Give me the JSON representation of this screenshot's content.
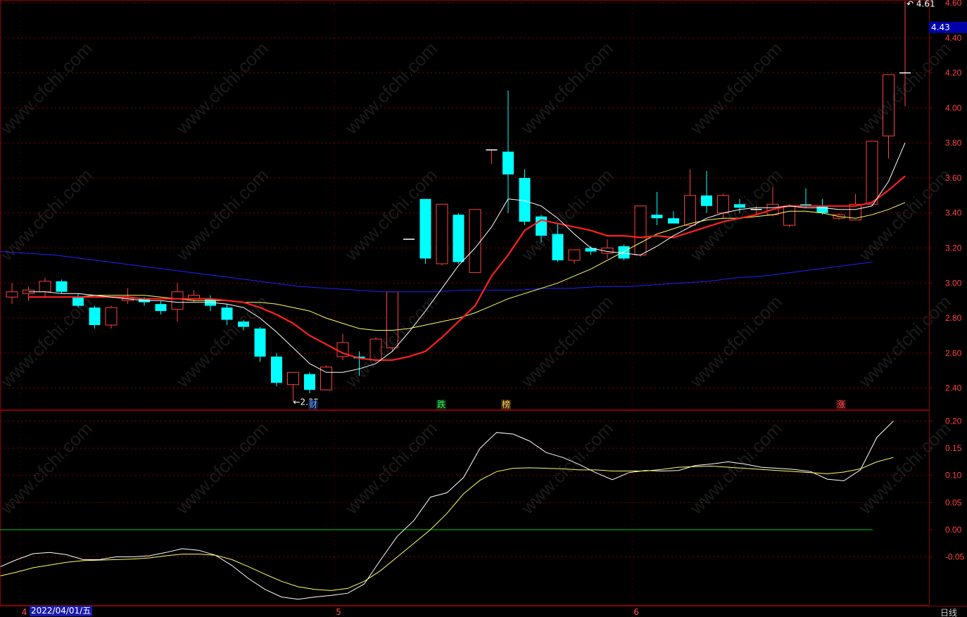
{
  "period_label": "日线",
  "current_price": "4.43",
  "cursor_date": "2022/04/01/五",
  "colors": {
    "up": "#ff4040",
    "down": "#00ffff",
    "ma_fast": "#ffffff",
    "ma_mid": "#ff2020",
    "ma_slow": "#ffff66",
    "ma_long": "#2020ff",
    "zero_line": "#00cc00",
    "grid": "#8b0000",
    "tick_text": "#ff4040"
  },
  "month_labels": [
    "4",
    "5",
    "6"
  ],
  "event_markers": [
    {
      "label": "财",
      "color": "#66aaff"
    },
    {
      "label": "跌",
      "color": "#33ff66"
    },
    {
      "label": "榜",
      "color": "#ffcc66"
    },
    {
      "label": "涨",
      "color": "#ff5555"
    }
  ],
  "annotations": {
    "low": "2.32",
    "high": "4.61"
  },
  "chart_data": [
    {
      "type": "candlestick",
      "ylim": [
        2.25,
        4.6
      ],
      "yticks": [
        "4.60",
        "4.40",
        "4.20",
        "4.00",
        "3.80",
        "3.60",
        "3.40",
        "3.20",
        "3.00",
        "2.80",
        "2.60",
        "2.40"
      ],
      "candles": [
        {
          "o": 2.92,
          "h": 3.0,
          "l": 2.88,
          "c": 2.95
        },
        {
          "o": 2.94,
          "h": 2.98,
          "l": 2.9,
          "c": 2.96
        },
        {
          "o": 2.95,
          "h": 3.03,
          "l": 2.92,
          "c": 3.01
        },
        {
          "o": 3.01,
          "h": 3.02,
          "l": 2.94,
          "c": 2.95
        },
        {
          "o": 2.92,
          "h": 2.94,
          "l": 2.86,
          "c": 2.87
        },
        {
          "o": 2.86,
          "h": 2.87,
          "l": 2.74,
          "c": 2.76
        },
        {
          "o": 2.76,
          "h": 2.87,
          "l": 2.74,
          "c": 2.86
        },
        {
          "o": 2.9,
          "h": 2.97,
          "l": 2.88,
          "c": 2.91
        },
        {
          "o": 2.91,
          "h": 2.92,
          "l": 2.87,
          "c": 2.89
        },
        {
          "o": 2.88,
          "h": 2.9,
          "l": 2.82,
          "c": 2.84
        },
        {
          "o": 2.85,
          "h": 3.0,
          "l": 2.78,
          "c": 2.95
        },
        {
          "o": 2.91,
          "h": 2.96,
          "l": 2.89,
          "c": 2.93
        },
        {
          "o": 2.91,
          "h": 2.93,
          "l": 2.84,
          "c": 2.87
        },
        {
          "o": 2.86,
          "h": 2.88,
          "l": 2.76,
          "c": 2.79
        },
        {
          "o": 2.78,
          "h": 2.79,
          "l": 2.73,
          "c": 2.75
        },
        {
          "o": 2.74,
          "h": 2.75,
          "l": 2.55,
          "c": 2.58
        },
        {
          "o": 2.58,
          "h": 2.6,
          "l": 2.41,
          "c": 2.43
        },
        {
          "o": 2.42,
          "h": 2.49,
          "l": 2.32,
          "c": 2.49
        },
        {
          "o": 2.48,
          "h": 2.49,
          "l": 2.37,
          "c": 2.39
        },
        {
          "o": 2.39,
          "h": 2.53,
          "l": 2.39,
          "c": 2.52
        },
        {
          "o": 2.58,
          "h": 2.71,
          "l": 2.56,
          "c": 2.66
        },
        {
          "o": 2.58,
          "h": 2.61,
          "l": 2.47,
          "c": 2.57
        },
        {
          "o": 2.56,
          "h": 2.69,
          "l": 2.55,
          "c": 2.68
        },
        {
          "o": 2.63,
          "h": 2.95,
          "l": 2.61,
          "c": 2.95
        },
        {
          "o": 3.25,
          "h": 3.25,
          "l": 3.25,
          "c": 3.25
        },
        {
          "o": 3.48,
          "h": 3.48,
          "l": 3.11,
          "c": 3.14
        },
        {
          "o": 3.11,
          "h": 3.45,
          "l": 3.1,
          "c": 3.45
        },
        {
          "o": 3.39,
          "h": 3.4,
          "l": 3.11,
          "c": 3.12
        },
        {
          "o": 3.06,
          "h": 3.42,
          "l": 3.06,
          "c": 3.42
        },
        {
          "o": 3.76,
          "h": 3.76,
          "l": 3.68,
          "c": 3.76
        },
        {
          "o": 3.75,
          "h": 4.1,
          "l": 3.4,
          "c": 3.62
        },
        {
          "o": 3.6,
          "h": 3.65,
          "l": 3.33,
          "c": 3.35
        },
        {
          "o": 3.38,
          "h": 3.39,
          "l": 3.23,
          "c": 3.27
        },
        {
          "o": 3.28,
          "h": 3.34,
          "l": 3.12,
          "c": 3.13
        },
        {
          "o": 3.13,
          "h": 3.19,
          "l": 3.11,
          "c": 3.19
        },
        {
          "o": 3.2,
          "h": 3.21,
          "l": 3.16,
          "c": 3.18
        },
        {
          "o": 3.17,
          "h": 3.25,
          "l": 3.14,
          "c": 3.2
        },
        {
          "o": 3.21,
          "h": 3.22,
          "l": 3.13,
          "c": 3.14
        },
        {
          "o": 3.16,
          "h": 3.44,
          "l": 3.15,
          "c": 3.44
        },
        {
          "o": 3.39,
          "h": 3.52,
          "l": 3.33,
          "c": 3.37
        },
        {
          "o": 3.37,
          "h": 3.41,
          "l": 3.36,
          "c": 3.34
        },
        {
          "o": 3.33,
          "h": 3.65,
          "l": 3.32,
          "c": 3.5
        },
        {
          "o": 3.5,
          "h": 3.64,
          "l": 3.4,
          "c": 3.44
        },
        {
          "o": 3.4,
          "h": 3.51,
          "l": 3.37,
          "c": 3.5
        },
        {
          "o": 3.45,
          "h": 3.48,
          "l": 3.4,
          "c": 3.43
        },
        {
          "o": 3.42,
          "h": 3.44,
          "l": 3.39,
          "c": 3.42
        },
        {
          "o": 3.39,
          "h": 3.55,
          "l": 3.38,
          "c": 3.45
        },
        {
          "o": 3.33,
          "h": 3.45,
          "l": 3.32,
          "c": 3.44
        },
        {
          "o": 3.45,
          "h": 3.54,
          "l": 3.43,
          "c": 3.44
        },
        {
          "o": 3.44,
          "h": 3.48,
          "l": 3.39,
          "c": 3.4
        },
        {
          "o": 3.37,
          "h": 3.4,
          "l": 3.36,
          "c": 3.39
        },
        {
          "o": 3.36,
          "h": 3.51,
          "l": 3.36,
          "c": 3.45
        },
        {
          "o": 3.45,
          "h": 3.81,
          "l": 3.44,
          "c": 3.81
        },
        {
          "o": 3.84,
          "h": 4.19,
          "l": 3.71,
          "c": 4.19
        },
        {
          "o": 4.2,
          "h": 4.61,
          "l": 4.01,
          "c": 4.2
        }
      ],
      "ma_fast": [
        2.95,
        2.95,
        2.94,
        2.94,
        2.93,
        2.92,
        2.91,
        2.9,
        2.9,
        2.89,
        2.89,
        2.89,
        2.88,
        2.86,
        2.8,
        2.72,
        2.63,
        2.54,
        2.49,
        2.49,
        2.51,
        2.54,
        2.61,
        2.72,
        2.84,
        2.97,
        3.1,
        3.2,
        3.32,
        3.48,
        3.47,
        3.44,
        3.37,
        3.28,
        3.2,
        3.18,
        3.17,
        3.16,
        3.21,
        3.27,
        3.32,
        3.37,
        3.4,
        3.42,
        3.43,
        3.43,
        3.44,
        3.43,
        3.43,
        3.42,
        3.42,
        3.44,
        3.58,
        3.8
      ],
      "ma_mid": [
        2.92,
        2.92,
        2.92,
        2.92,
        2.92,
        2.92,
        2.92,
        2.91,
        2.91,
        2.91,
        2.91,
        2.91,
        2.9,
        2.89,
        2.86,
        2.82,
        2.77,
        2.7,
        2.65,
        2.6,
        2.57,
        2.56,
        2.56,
        2.58,
        2.61,
        2.69,
        2.78,
        2.87,
        3.04,
        3.16,
        3.3,
        3.36,
        3.34,
        3.32,
        3.3,
        3.27,
        3.27,
        3.26,
        3.27,
        3.26,
        3.29,
        3.32,
        3.35,
        3.37,
        3.39,
        3.42,
        3.44,
        3.44,
        3.44,
        3.44,
        3.44,
        3.46,
        3.53,
        3.61
      ],
      "ma_slow": [
        2.92,
        2.93,
        2.93,
        2.93,
        2.93,
        2.92,
        2.91,
        2.9,
        2.9,
        2.9,
        2.89,
        2.89,
        2.88,
        2.86,
        2.84,
        2.8,
        2.77,
        2.74,
        2.73,
        2.73,
        2.74,
        2.76,
        2.78,
        2.8,
        2.83,
        2.87,
        2.91,
        2.94,
        2.97,
        3.0,
        3.04,
        3.08,
        3.13,
        3.18,
        3.23,
        3.28,
        3.31,
        3.34,
        3.36,
        3.37,
        3.37,
        3.38,
        3.39,
        3.41,
        3.41,
        3.4,
        3.38,
        3.37,
        3.39,
        3.42,
        3.46
      ],
      "ma_long": [
        3.18,
        3.17,
        3.16,
        3.14,
        3.12,
        3.1,
        3.08,
        3.06,
        3.04,
        3.02,
        3.0,
        2.98,
        2.97,
        2.96,
        2.95,
        2.95,
        2.95,
        2.96,
        2.96,
        2.96,
        2.97,
        2.97,
        2.98,
        2.98,
        2.99,
        3.0,
        3.01,
        3.03,
        3.04,
        3.06,
        3.08,
        3.1,
        3.12
      ]
    },
    {
      "type": "line",
      "ylim": [
        -0.14,
        0.22
      ],
      "yticks": [
        "0.20",
        "0.15",
        "0.10",
        "0.05",
        "0.00",
        "-0.05"
      ],
      "series": [
        {
          "color": "#ffffff",
          "values": [
            -0.068,
            -0.055,
            -0.044,
            -0.042,
            -0.046,
            -0.055,
            -0.055,
            -0.05,
            -0.05,
            -0.048,
            -0.042,
            -0.035,
            -0.038,
            -0.047,
            -0.066,
            -0.09,
            -0.11,
            -0.124,
            -0.128,
            -0.124,
            -0.121,
            -0.117,
            -0.1,
            -0.055,
            -0.012,
            0.017,
            0.06,
            0.068,
            0.096,
            0.15,
            0.179,
            0.176,
            0.163,
            0.142,
            0.133,
            0.12,
            0.105,
            0.092,
            0.105,
            0.109,
            0.108,
            0.109,
            0.118,
            0.121,
            0.125,
            0.121,
            0.115,
            0.113,
            0.111,
            0.107,
            0.093,
            0.09,
            0.11,
            0.17,
            0.2
          ]
        },
        {
          "color": "#ffff66",
          "values": [
            -0.085,
            -0.078,
            -0.07,
            -0.065,
            -0.06,
            -0.057,
            -0.056,
            -0.055,
            -0.054,
            -0.052,
            -0.048,
            -0.045,
            -0.045,
            -0.047,
            -0.055,
            -0.068,
            -0.082,
            -0.095,
            -0.105,
            -0.11,
            -0.112,
            -0.108,
            -0.095,
            -0.075,
            -0.05,
            -0.025,
            0.0,
            0.03,
            0.066,
            0.091,
            0.107,
            0.113,
            0.114,
            0.113,
            0.112,
            0.11,
            0.11,
            0.108,
            0.108,
            0.108,
            0.111,
            0.115,
            0.116,
            0.117,
            0.115,
            0.113,
            0.111,
            0.109,
            0.107,
            0.105,
            0.103,
            0.106,
            0.112,
            0.125,
            0.133
          ]
        }
      ]
    }
  ]
}
